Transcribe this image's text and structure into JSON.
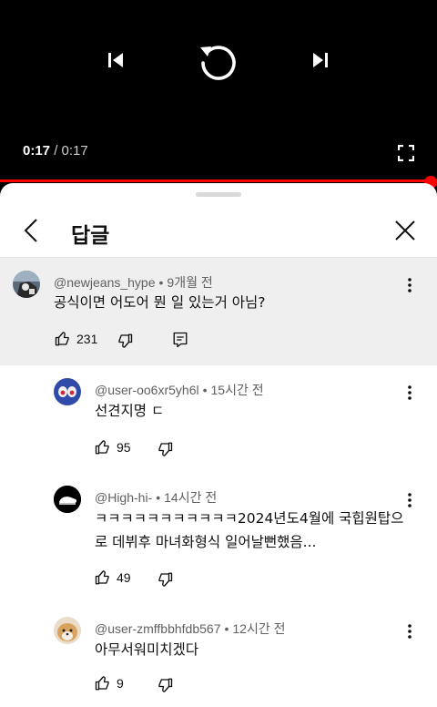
{
  "player": {
    "current_time": "0:17",
    "separator": " / ",
    "duration": "0:17",
    "progress_fraction": 1.0,
    "accent_color": "#ff0000"
  },
  "sheet": {
    "title": "답글"
  },
  "parent_comment": {
    "author": "@newjeans_hype",
    "age": "9개월 전",
    "text": "공식이면 어도어 뭔 일 있는거 아님?",
    "likes": "231",
    "highlight_color": "#efefef"
  },
  "replies": [
    {
      "author": "@user-oo6xr5yh6l",
      "age": "15시간 전",
      "text": "선견지명 ㄷ",
      "likes": "95"
    },
    {
      "author": "@High-hi-",
      "age": "14시간 전",
      "text_line1": "ㅋㅋㅋㅋㅋㅋㅋㅋㅋㅋㅋ2024년도4월에 국힙원탑으",
      "text_line2": "로 데뷔후 마녀화형식 일어날뻔했음...",
      "likes": "49"
    },
    {
      "author": "@user-zmffbbhfdb567",
      "age": "12시간 전",
      "text": "아무서워미치겠다",
      "likes": "9"
    }
  ],
  "icons": {
    "previous": "skip-previous-icon",
    "replay": "replay-icon",
    "next": "skip-next-icon",
    "fullscreen": "fullscreen-icon",
    "back": "chevron-left-icon",
    "close": "close-icon",
    "more": "more-vert-icon",
    "like": "thumbs-up-icon",
    "dislike": "thumbs-down-icon",
    "reply": "reply-comment-icon"
  }
}
